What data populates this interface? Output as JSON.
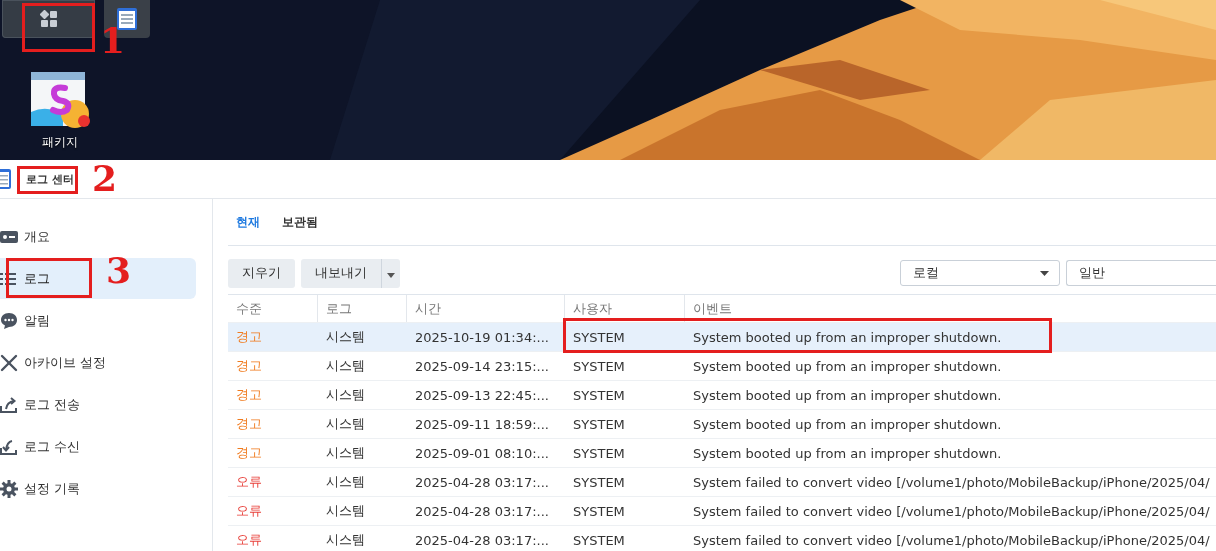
{
  "taskbar": {
    "items": [
      {
        "kind": "apps",
        "selected": true
      },
      {
        "kind": "log",
        "selected": false
      }
    ]
  },
  "desktop": {
    "icons": [
      {
        "label": "패키지",
        "badge": true
      }
    ]
  },
  "window": {
    "title": "로그 센터"
  },
  "sidebar": {
    "items": [
      {
        "kind": "overview",
        "label": "개요",
        "selected": false
      },
      {
        "kind": "list",
        "label": "로그",
        "selected": true
      },
      {
        "kind": "chat",
        "label": "알림",
        "selected": false
      },
      {
        "kind": "tools",
        "label": "아카이브 설정",
        "selected": false
      },
      {
        "kind": "send",
        "label": "로그 전송",
        "selected": false
      },
      {
        "kind": "receive",
        "label": "로그 수신",
        "selected": false
      },
      {
        "kind": "gear",
        "label": "설정 기록",
        "selected": false
      }
    ]
  },
  "tabs": [
    {
      "label": "현재",
      "selected": true
    },
    {
      "label": "보관됨",
      "selected": false
    }
  ],
  "toolbar": {
    "clear": "지우기",
    "export": "내보내기",
    "source": "로컬",
    "filter": "일반"
  },
  "table": {
    "columns": [
      "수준",
      "로그",
      "시간",
      "사용자",
      "이벤트"
    ],
    "rows": [
      {
        "kind": "warning",
        "selected": true,
        "cells": [
          "경고",
          "시스템",
          "2025-10-19 01:34:...",
          "SYSTEM",
          "System booted up from an improper shutdown."
        ]
      },
      {
        "kind": "warning",
        "selected": false,
        "cells": [
          "경고",
          "시스템",
          "2025-09-14 23:15:...",
          "SYSTEM",
          "System booted up from an improper shutdown."
        ]
      },
      {
        "kind": "warning",
        "selected": false,
        "cells": [
          "경고",
          "시스템",
          "2025-09-13 22:45:...",
          "SYSTEM",
          "System booted up from an improper shutdown."
        ]
      },
      {
        "kind": "warning",
        "selected": false,
        "cells": [
          "경고",
          "시스템",
          "2025-09-11 18:59:...",
          "SYSTEM",
          "System booted up from an improper shutdown."
        ]
      },
      {
        "kind": "warning",
        "selected": false,
        "cells": [
          "경고",
          "시스템",
          "2025-09-01 08:10:...",
          "SYSTEM",
          "System booted up from an improper shutdown."
        ]
      },
      {
        "kind": "error",
        "selected": false,
        "cells": [
          "오류",
          "시스템",
          "2025-04-28 03:17:...",
          "SYSTEM",
          "System failed to convert video [/volume1/photo/MobileBackup/iPhone/2025/04/"
        ]
      },
      {
        "kind": "error",
        "selected": false,
        "cells": [
          "오류",
          "시스템",
          "2025-04-28 03:17:...",
          "SYSTEM",
          "System failed to convert video [/volume1/photo/MobileBackup/iPhone/2025/04/"
        ]
      },
      {
        "kind": "error",
        "selected": false,
        "cells": [
          "오류",
          "시스템",
          "2025-04-28 03:17:...",
          "SYSTEM",
          "System failed to convert video [/volume1/photo/MobileBackup/iPhone/2025/04/"
        ]
      }
    ]
  },
  "annotations": [
    {
      "kind": "box"
    },
    {
      "kind": "number",
      "label": "1"
    },
    {
      "kind": "box"
    },
    {
      "kind": "number",
      "label": "2"
    },
    {
      "kind": "box"
    },
    {
      "kind": "number",
      "label": "3"
    },
    {
      "kind": "box"
    }
  ]
}
